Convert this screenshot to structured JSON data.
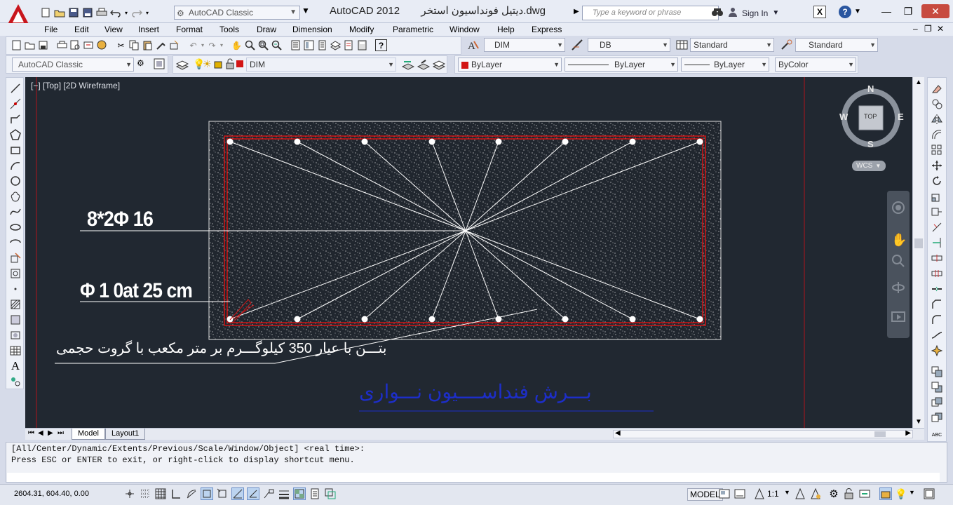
{
  "title_bar": {
    "workspace": "AutoCAD Classic",
    "title": "AutoCAD 2012",
    "filename": "دیتیل فونداسیون استخر.dwg",
    "search_placeholder": "Type a keyword or phrase",
    "sign_in": "Sign In"
  },
  "menu": [
    "File",
    "Edit",
    "View",
    "Insert",
    "Format",
    "Tools",
    "Draw",
    "Dimension",
    "Modify",
    "Parametric",
    "Window",
    "Help",
    "Express"
  ],
  "toolbar": {
    "dimstyle": "DIM",
    "multileader_style": "DB",
    "table_style": "Standard",
    "mleader_style": "Standard",
    "workspace2": "AutoCAD Classic",
    "layer": "DIM",
    "color": "ByLayer",
    "linetype": "ByLayer",
    "lineweight": "ByLayer",
    "plotstyle": "ByColor"
  },
  "viewport": {
    "label": "[−] [Top] [2D Wireframe]",
    "viewcube": {
      "n": "N",
      "s": "S",
      "e": "E",
      "w": "W",
      "top": "TOP",
      "wcs": "WCS"
    }
  },
  "drawing": {
    "rebar_label": "8*2Φ 16",
    "stirrup_label": "Φ 1 0at 25 cm",
    "concrete_note": "بتـــن  با  عیار  350  کیلوگـــرم  بر  متر  مکعب  با  گروت  حجمی",
    "section_title": "بـــرش  فنداســــیون  نـــواری"
  },
  "tabs": [
    "Model",
    "Layout1"
  ],
  "command": {
    "line1": "[All/Center/Dynamic/Extents/Previous/Scale/Window/Object] <real time>:",
    "line2": "Press ESC or ENTER to exit, or right-click to display shortcut menu."
  },
  "status": {
    "coords": "2604.31, 604.40, 0.00",
    "model": "MODEL",
    "scale": "1:1"
  },
  "colors": {
    "canvas": "#212831",
    "rebar_red": "#d21414",
    "title_blue": "#1d2ec8"
  }
}
